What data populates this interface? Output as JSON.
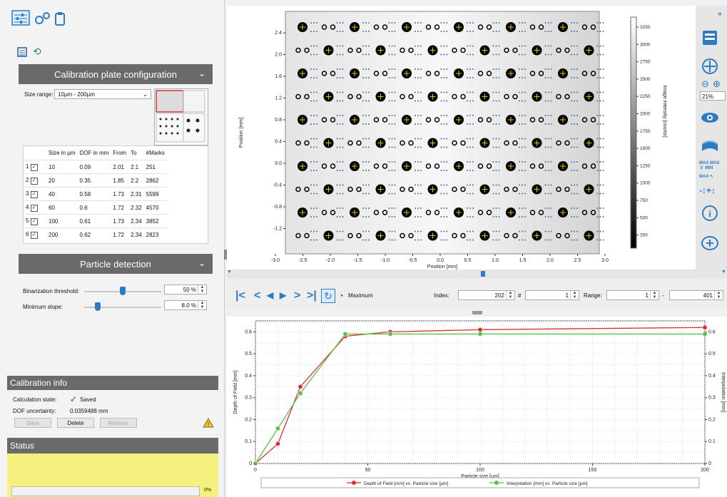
{
  "left": {
    "config": {
      "title": "Calibration plate configuration",
      "size_range_label": "Size range:",
      "size_range_value": "10µm - 200µm",
      "columns": [
        "Size in µm",
        "DOF in mm",
        "From",
        "To",
        "#Marks"
      ],
      "rows": [
        {
          "idx": "1",
          "size": "10",
          "dof": "0.09",
          "from": "2.01",
          "to": "2.1",
          "marks": "251"
        },
        {
          "idx": "2",
          "size": "20",
          "dof": "0.35",
          "from": "1.85",
          "to": "2.2",
          "marks": "2862"
        },
        {
          "idx": "3",
          "size": "40",
          "dof": "0.58",
          "from": "1.73",
          "to": "2.31",
          "marks": "5599"
        },
        {
          "idx": "4",
          "size": "60",
          "dof": "0.6",
          "from": "1.72",
          "to": "2.32",
          "marks": "4570"
        },
        {
          "idx": "5",
          "size": "100",
          "dof": "0.61",
          "from": "1.73",
          "to": "2.34",
          "marks": "3852"
        },
        {
          "idx": "6",
          "size": "200",
          "dof": "0.62",
          "from": "1.72",
          "to": "2.34",
          "marks": "2823"
        }
      ]
    },
    "particle": {
      "title": "Particle detection",
      "binarization_label": "Binarization threshold:",
      "binarization_value": "50 %",
      "binarization_level": 0.5,
      "slope_label": "Minimum slope:",
      "slope_value": "8.0 %",
      "slope_level": 0.15
    },
    "calib_info": {
      "title": "Calibration info",
      "state_label": "Calculation state:",
      "state_value": "Saved",
      "dof_label": "DOF uncertainty:",
      "dof_value": "0.0359488 mm",
      "save": "Save",
      "delete": "Delete",
      "restore": "Restore"
    },
    "status": {
      "title": "Status",
      "percent": "0%",
      "progress": 0
    }
  },
  "image_view": {
    "x_label": "Position [mm]",
    "y_label": "Position [mm]",
    "cbar_label": "Image intensity [counts]",
    "x_ticks": [
      "-3.0",
      "-2.5",
      "-2.0",
      "-1.5",
      "-1.0",
      "-0.5",
      "0.0",
      "0.5",
      "1.0",
      "1.5",
      "2.0",
      "2.5",
      "3.0"
    ],
    "y_ticks": [
      "2.4",
      "2.0",
      "1.6",
      "1.2",
      "0.8",
      "0.4",
      "0.0",
      "-0.4",
      "-0.8",
      "-1.2"
    ],
    "cbar_ticks": [
      "3250",
      "3000",
      "2750",
      "2500",
      "2250",
      "2000",
      "1750",
      "1500",
      "1250",
      "1000",
      "750",
      "500",
      "250"
    ],
    "zoom": "21%",
    "colors": {
      "accent": "#2e7bc4"
    }
  },
  "nav": {
    "maximum_label": "Maximum",
    "index_label": "Index:",
    "index_value": "202",
    "step_value": "1",
    "range_label": "Range:",
    "range_from": "1",
    "range_to": "401",
    "hash": "#",
    "dash": "-"
  },
  "chart_data": {
    "type": "line",
    "xlabel": "Particle size [µm]",
    "ylabel": "Depth of Field [mm]",
    "ylabel_right": "Interpolation [mm]",
    "xlim": [
      0,
      200
    ],
    "ylim": [
      0,
      0.65
    ],
    "x_ticks": [
      "0",
      "50",
      "100",
      "150",
      "200"
    ],
    "y_ticks": [
      "0",
      "0.1",
      "0.2",
      "0.3",
      "0.4",
      "0.5",
      "0.6"
    ],
    "grid": true,
    "legend_position": "bottom",
    "series": [
      {
        "name": "Depth of Field [mm] vs. Particle size [µm]",
        "color": "#d9302c",
        "x": [
          0,
          10,
          20,
          40,
          60,
          100,
          200
        ],
        "y": [
          0,
          0.09,
          0.35,
          0.58,
          0.6,
          0.61,
          0.62
        ]
      },
      {
        "name": "Interpolation [mm] vs. Particle size [µm]",
        "color": "#5cbf4a",
        "x": [
          0,
          10,
          20,
          40,
          60,
          100,
          200
        ],
        "y": [
          0,
          0.16,
          0.32,
          0.59,
          0.59,
          0.59,
          0.59
        ]
      }
    ]
  }
}
